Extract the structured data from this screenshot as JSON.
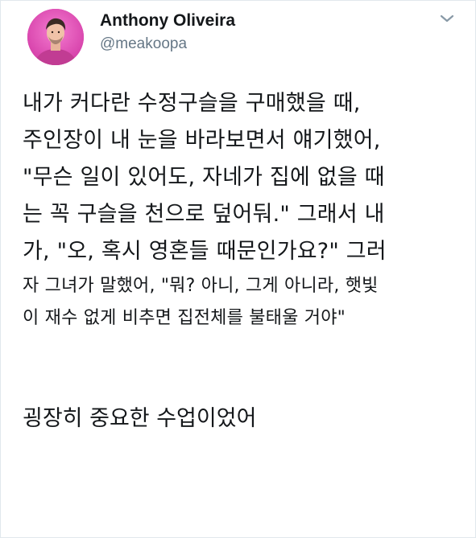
{
  "user": {
    "display_name": "Anthony Oliveira",
    "handle": "@meakoopa"
  },
  "icons": {
    "menu": "chevron-down-icon",
    "avatar": "avatar-image"
  },
  "tweet": {
    "lines_large": [
      "내가 커다란 수정구슬을 구매했을 때,",
      "주인장이 내 눈을 바라보면서 얘기했어,",
      "\"무슨 일이 있어도, 자네가 집에 없을 때",
      "는 꼭 구슬을 천으로 덮어둬.\" 그래서 내",
      "가, \"오, 혹시 영혼들 때문인가요?\" 그러"
    ],
    "lines_small": [
      "자 그녀가 말했어, \"뭐? 아니, 그게 아니라, 햇빛",
      "이 재수 없게 비추면 집전체를 불태울 거야\""
    ],
    "closing": "굉장히 중요한 수업이었어"
  },
  "colors": {
    "text": "#14171a",
    "secondary": "#657786",
    "avatar_bg": "#e04fb8",
    "border": "#e1e8ed"
  }
}
